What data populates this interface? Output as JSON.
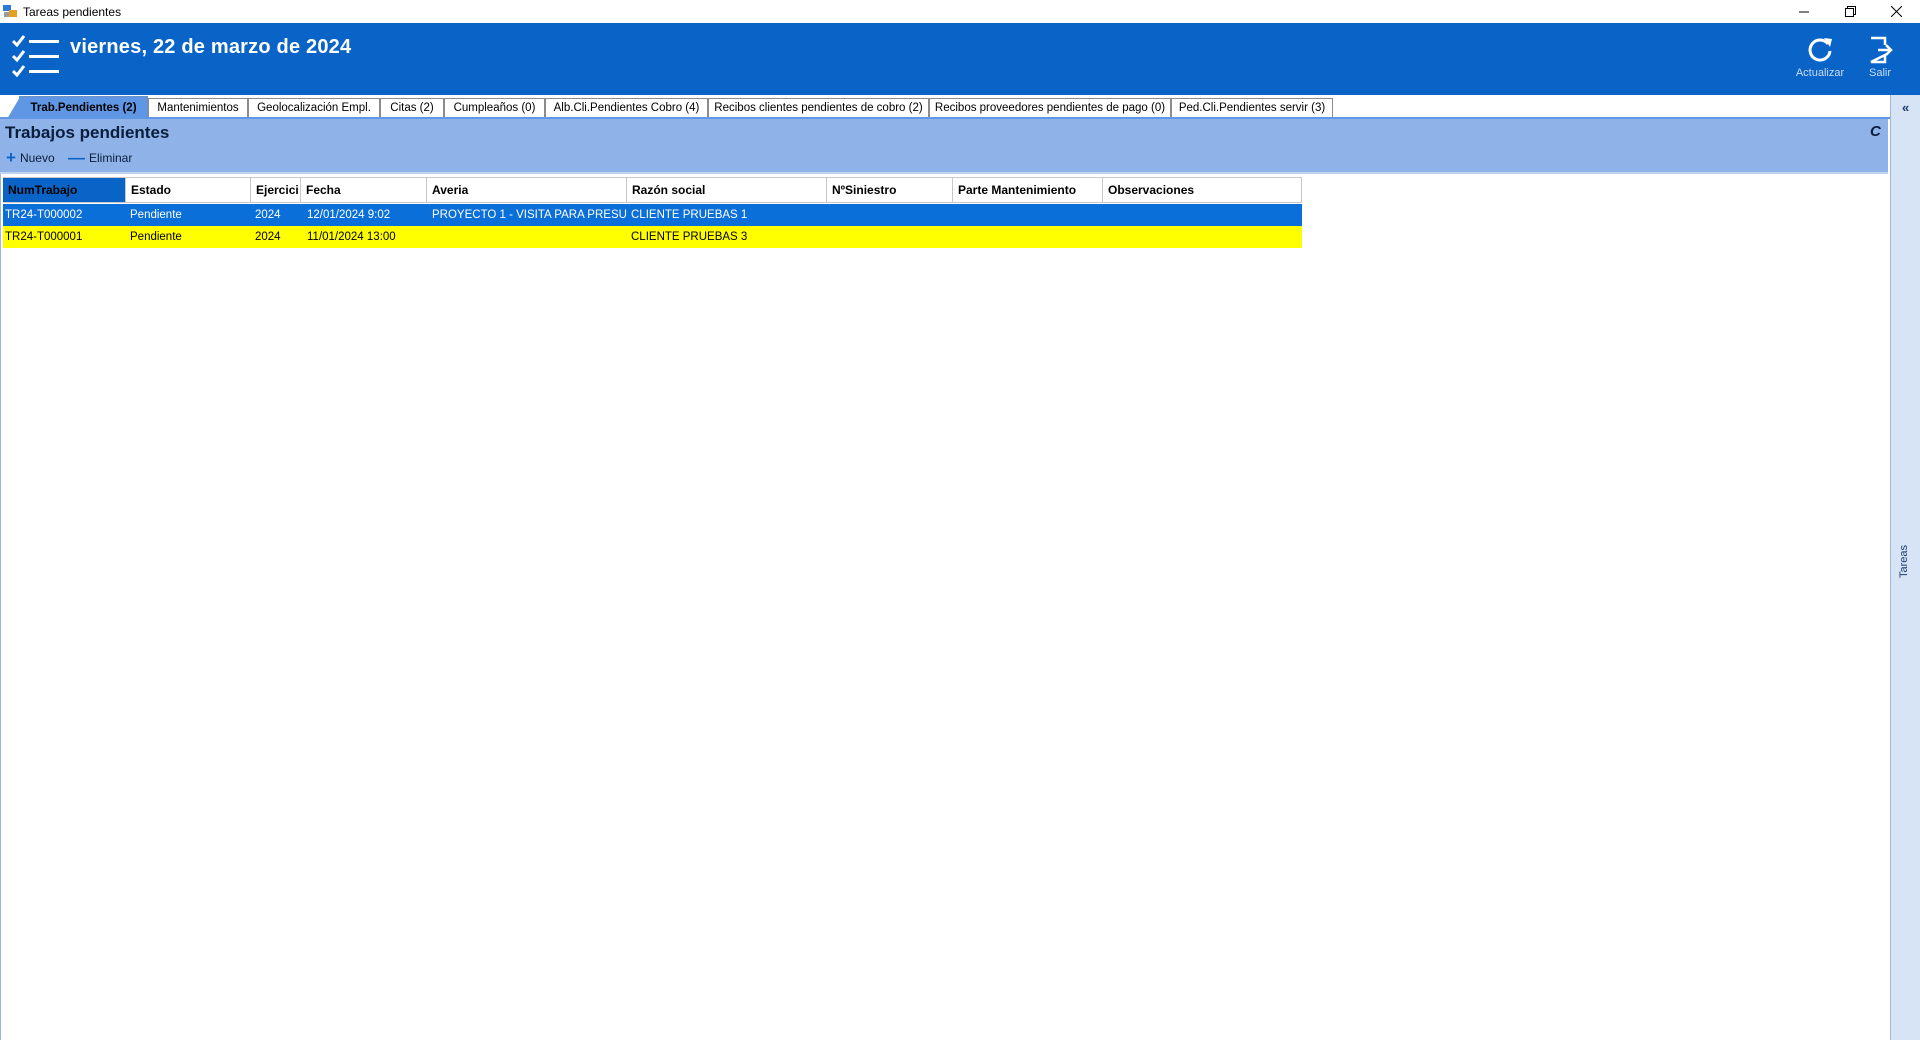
{
  "window": {
    "title": "Tareas pendientes",
    "controls": [
      "minimize-icon",
      "restore-icon",
      "close-icon"
    ]
  },
  "header": {
    "date": "viernes, 22 de marzo de 2024",
    "buttons": [
      {
        "label": "Actualizar",
        "icon": "refresh-icon"
      },
      {
        "label": "Salir",
        "icon": "exit-icon"
      }
    ]
  },
  "tabs": [
    {
      "label": "Trab.Pendientes (2)",
      "active": true
    },
    {
      "label": "Mantenimientos"
    },
    {
      "label": "Geolocalización Empl."
    },
    {
      "label": "Citas (2)"
    },
    {
      "label": "Cumpleaños (0)"
    },
    {
      "label": "Alb.Cli.Pendientes Cobro (4)"
    },
    {
      "label": "Recibos clientes pendientes de cobro (2)"
    },
    {
      "label": "Recibos proveedores pendientes de pago (0)"
    },
    {
      "label": "Ped.Cli.Pendientes servir (3)"
    }
  ],
  "side_panel": {
    "label": "Tareas",
    "icon": "double-chevron-left-icon"
  },
  "section": {
    "title": "Trabajos pendientes",
    "refresh_icon": "refresh-small-icon",
    "toolbar": {
      "new_label": "Nuevo",
      "delete_label": "Eliminar"
    }
  },
  "grid": {
    "columns": [
      "NumTrabajo",
      "Estado",
      "Ejercici",
      "Fecha",
      "Averia",
      "Razón social",
      "NºSiniestro",
      "Parte Mantenimiento",
      "Observaciones"
    ],
    "rows": [
      {
        "num": "TR24-T000002",
        "estado": "Pendiente",
        "ejercicio": "2024",
        "fecha": "12/01/2024 9:02",
        "averia": "PROYECTO 1 - VISITA PARA PRESU...",
        "razon": "CLIENTE PRUEBAS 1",
        "siniestro": "",
        "parte": "",
        "obs": "",
        "style": "selected"
      },
      {
        "num": "TR24-T000001",
        "estado": "Pendiente",
        "ejercicio": "2024",
        "fecha": "11/01/2024 13:00",
        "averia": "",
        "razon": "CLIENTE PRUEBAS 3",
        "siniestro": "",
        "parte": "",
        "obs": "",
        "style": "yellow"
      }
    ]
  },
  "colors": {
    "header_blue": "#0a64c8",
    "section_blue": "#8fb3e8",
    "row_selected": "#0a6fd8",
    "row_highlight": "#ffff00"
  }
}
